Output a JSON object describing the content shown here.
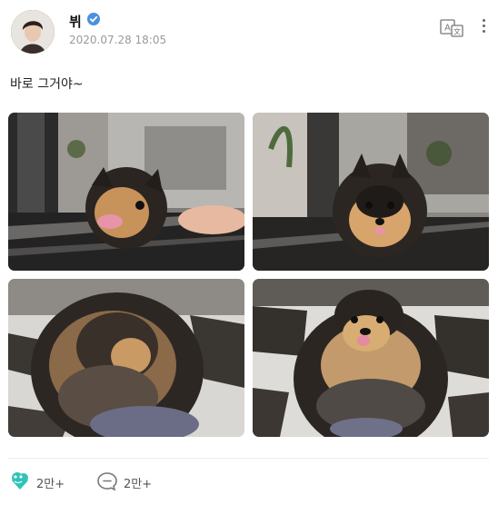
{
  "post": {
    "author_name": "뷔",
    "date": "2020.07.28 18:05",
    "text": "바로 그거야~",
    "translate_icon": "translate-icon",
    "more_icon": "more-vertical-icon",
    "verified_color": "#4a90e2"
  },
  "photos": [
    {
      "alt": "photo-1"
    },
    {
      "alt": "photo-2"
    },
    {
      "alt": "photo-3"
    },
    {
      "alt": "photo-4"
    }
  ],
  "actions": {
    "likes": "2만+",
    "comments": "2만+",
    "like_color": "#2ec4b6"
  }
}
